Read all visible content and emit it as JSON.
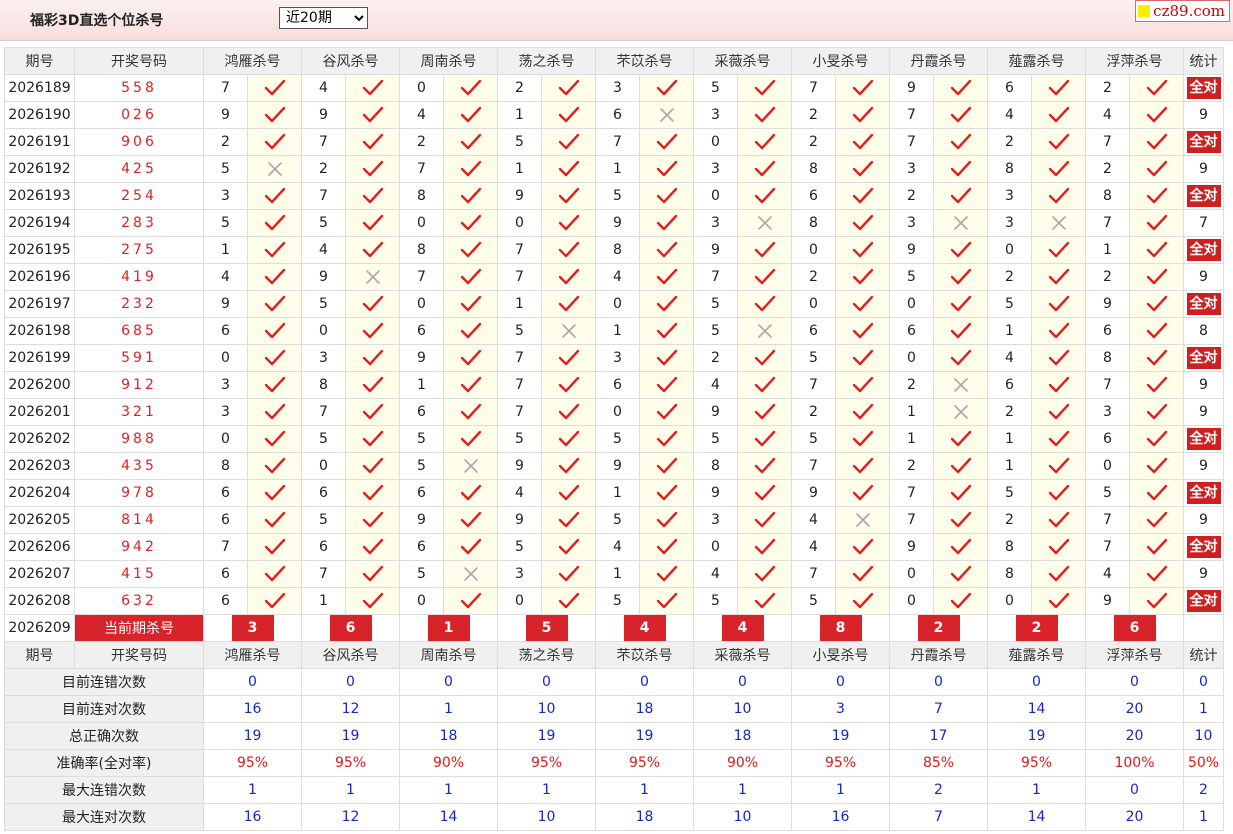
{
  "header": {
    "title": "福彩3D直选个位杀号",
    "period_select": "近20期",
    "brand": "cz89.com"
  },
  "columns": [
    "期号",
    "开奖号码",
    "鸿雁杀号",
    "谷风杀号",
    "周南杀号",
    "荡之杀号",
    "芣苡杀号",
    "采薇杀号",
    "小旻杀号",
    "丹霞杀号",
    "薤露杀号",
    "浮萍杀号",
    "统计"
  ],
  "rows": [
    {
      "q": "2026189",
      "kj": "558",
      "k": [
        [
          "7",
          1
        ],
        [
          "4",
          1
        ],
        [
          "0",
          1
        ],
        [
          "2",
          1
        ],
        [
          "3",
          1
        ],
        [
          "5",
          1
        ],
        [
          "7",
          1
        ],
        [
          "9",
          1
        ],
        [
          "6",
          1
        ],
        [
          "2",
          1
        ]
      ],
      "tj": "全对"
    },
    {
      "q": "2026190",
      "kj": "026",
      "k": [
        [
          "9",
          1
        ],
        [
          "9",
          1
        ],
        [
          "4",
          1
        ],
        [
          "1",
          1
        ],
        [
          "6",
          0
        ],
        [
          "3",
          1
        ],
        [
          "2",
          1
        ],
        [
          "7",
          1
        ],
        [
          "4",
          1
        ],
        [
          "4",
          1
        ]
      ],
      "tj": "9"
    },
    {
      "q": "2026191",
      "kj": "906",
      "k": [
        [
          "2",
          1
        ],
        [
          "7",
          1
        ],
        [
          "2",
          1
        ],
        [
          "5",
          1
        ],
        [
          "7",
          1
        ],
        [
          "0",
          1
        ],
        [
          "2",
          1
        ],
        [
          "7",
          1
        ],
        [
          "2",
          1
        ],
        [
          "7",
          1
        ]
      ],
      "tj": "全对"
    },
    {
      "q": "2026192",
      "kj": "425",
      "k": [
        [
          "5",
          0
        ],
        [
          "2",
          1
        ],
        [
          "7",
          1
        ],
        [
          "1",
          1
        ],
        [
          "1",
          1
        ],
        [
          "3",
          1
        ],
        [
          "8",
          1
        ],
        [
          "3",
          1
        ],
        [
          "8",
          1
        ],
        [
          "2",
          1
        ]
      ],
      "tj": "9"
    },
    {
      "q": "2026193",
      "kj": "254",
      "k": [
        [
          "3",
          1
        ],
        [
          "7",
          1
        ],
        [
          "8",
          1
        ],
        [
          "9",
          1
        ],
        [
          "5",
          1
        ],
        [
          "0",
          1
        ],
        [
          "6",
          1
        ],
        [
          "2",
          1
        ],
        [
          "3",
          1
        ],
        [
          "8",
          1
        ]
      ],
      "tj": "全对"
    },
    {
      "q": "2026194",
      "kj": "283",
      "k": [
        [
          "5",
          1
        ],
        [
          "5",
          1
        ],
        [
          "0",
          1
        ],
        [
          "0",
          1
        ],
        [
          "9",
          1
        ],
        [
          "3",
          0
        ],
        [
          "8",
          1
        ],
        [
          "3",
          0
        ],
        [
          "3",
          0
        ],
        [
          "7",
          1
        ]
      ],
      "tj": "7"
    },
    {
      "q": "2026195",
      "kj": "275",
      "k": [
        [
          "1",
          1
        ],
        [
          "4",
          1
        ],
        [
          "8",
          1
        ],
        [
          "7",
          1
        ],
        [
          "8",
          1
        ],
        [
          "9",
          1
        ],
        [
          "0",
          1
        ],
        [
          "9",
          1
        ],
        [
          "0",
          1
        ],
        [
          "1",
          1
        ]
      ],
      "tj": "全对"
    },
    {
      "q": "2026196",
      "kj": "419",
      "k": [
        [
          "4",
          1
        ],
        [
          "9",
          0
        ],
        [
          "7",
          1
        ],
        [
          "7",
          1
        ],
        [
          "4",
          1
        ],
        [
          "7",
          1
        ],
        [
          "2",
          1
        ],
        [
          "5",
          1
        ],
        [
          "2",
          1
        ],
        [
          "2",
          1
        ]
      ],
      "tj": "9"
    },
    {
      "q": "2026197",
      "kj": "232",
      "k": [
        [
          "9",
          1
        ],
        [
          "5",
          1
        ],
        [
          "0",
          1
        ],
        [
          "1",
          1
        ],
        [
          "0",
          1
        ],
        [
          "5",
          1
        ],
        [
          "0",
          1
        ],
        [
          "0",
          1
        ],
        [
          "5",
          1
        ],
        [
          "9",
          1
        ]
      ],
      "tj": "全对"
    },
    {
      "q": "2026198",
      "kj": "685",
      "k": [
        [
          "6",
          1
        ],
        [
          "0",
          1
        ],
        [
          "6",
          1
        ],
        [
          "5",
          0
        ],
        [
          "1",
          1
        ],
        [
          "5",
          0
        ],
        [
          "6",
          1
        ],
        [
          "6",
          1
        ],
        [
          "1",
          1
        ],
        [
          "6",
          1
        ]
      ],
      "tj": "8"
    },
    {
      "q": "2026199",
      "kj": "591",
      "k": [
        [
          "0",
          1
        ],
        [
          "3",
          1
        ],
        [
          "9",
          1
        ],
        [
          "7",
          1
        ],
        [
          "3",
          1
        ],
        [
          "2",
          1
        ],
        [
          "5",
          1
        ],
        [
          "0",
          1
        ],
        [
          "4",
          1
        ],
        [
          "8",
          1
        ]
      ],
      "tj": "全对"
    },
    {
      "q": "2026200",
      "kj": "912",
      "k": [
        [
          "3",
          1
        ],
        [
          "8",
          1
        ],
        [
          "1",
          1
        ],
        [
          "7",
          1
        ],
        [
          "6",
          1
        ],
        [
          "4",
          1
        ],
        [
          "7",
          1
        ],
        [
          "2",
          0
        ],
        [
          "6",
          1
        ],
        [
          "7",
          1
        ]
      ],
      "tj": "9"
    },
    {
      "q": "2026201",
      "kj": "321",
      "k": [
        [
          "3",
          1
        ],
        [
          "7",
          1
        ],
        [
          "6",
          1
        ],
        [
          "7",
          1
        ],
        [
          "0",
          1
        ],
        [
          "9",
          1
        ],
        [
          "2",
          1
        ],
        [
          "1",
          0
        ],
        [
          "2",
          1
        ],
        [
          "3",
          1
        ]
      ],
      "tj": "9"
    },
    {
      "q": "2026202",
      "kj": "988",
      "k": [
        [
          "0",
          1
        ],
        [
          "5",
          1
        ],
        [
          "5",
          1
        ],
        [
          "5",
          1
        ],
        [
          "5",
          1
        ],
        [
          "5",
          1
        ],
        [
          "5",
          1
        ],
        [
          "1",
          1
        ],
        [
          "1",
          1
        ],
        [
          "6",
          1
        ]
      ],
      "tj": "全对"
    },
    {
      "q": "2026203",
      "kj": "435",
      "k": [
        [
          "8",
          1
        ],
        [
          "0",
          1
        ],
        [
          "5",
          0
        ],
        [
          "9",
          1
        ],
        [
          "9",
          1
        ],
        [
          "8",
          1
        ],
        [
          "7",
          1
        ],
        [
          "2",
          1
        ],
        [
          "1",
          1
        ],
        [
          "0",
          1
        ]
      ],
      "tj": "9"
    },
    {
      "q": "2026204",
      "kj": "978",
      "k": [
        [
          "6",
          1
        ],
        [
          "6",
          1
        ],
        [
          "6",
          1
        ],
        [
          "4",
          1
        ],
        [
          "1",
          1
        ],
        [
          "9",
          1
        ],
        [
          "9",
          1
        ],
        [
          "7",
          1
        ],
        [
          "5",
          1
        ],
        [
          "5",
          1
        ]
      ],
      "tj": "全对"
    },
    {
      "q": "2026205",
      "kj": "814",
      "k": [
        [
          "6",
          1
        ],
        [
          "5",
          1
        ],
        [
          "9",
          1
        ],
        [
          "9",
          1
        ],
        [
          "5",
          1
        ],
        [
          "3",
          1
        ],
        [
          "4",
          0
        ],
        [
          "7",
          1
        ],
        [
          "2",
          1
        ],
        [
          "7",
          1
        ]
      ],
      "tj": "9"
    },
    {
      "q": "2026206",
      "kj": "942",
      "k": [
        [
          "7",
          1
        ],
        [
          "6",
          1
        ],
        [
          "6",
          1
        ],
        [
          "5",
          1
        ],
        [
          "4",
          1
        ],
        [
          "0",
          1
        ],
        [
          "4",
          1
        ],
        [
          "9",
          1
        ],
        [
          "8",
          1
        ],
        [
          "7",
          1
        ]
      ],
      "tj": "全对"
    },
    {
      "q": "2026207",
      "kj": "415",
      "k": [
        [
          "6",
          1
        ],
        [
          "7",
          1
        ],
        [
          "5",
          0
        ],
        [
          "3",
          1
        ],
        [
          "1",
          1
        ],
        [
          "4",
          1
        ],
        [
          "7",
          1
        ],
        [
          "0",
          1
        ],
        [
          "8",
          1
        ],
        [
          "4",
          1
        ]
      ],
      "tj": "9"
    },
    {
      "q": "2026208",
      "kj": "632",
      "k": [
        [
          "6",
          1
        ],
        [
          "1",
          1
        ],
        [
          "0",
          1
        ],
        [
          "0",
          1
        ],
        [
          "5",
          1
        ],
        [
          "5",
          1
        ],
        [
          "5",
          1
        ],
        [
          "0",
          1
        ],
        [
          "0",
          1
        ],
        [
          "9",
          1
        ]
      ],
      "tj": "全对"
    }
  ],
  "current": {
    "q": "2026209",
    "label": "当前期杀号",
    "k": [
      "3",
      "6",
      "1",
      "5",
      "4",
      "4",
      "8",
      "2",
      "2",
      "6"
    ]
  },
  "stats": [
    {
      "label": "目前连错次数",
      "v": [
        "0",
        "0",
        "0",
        "0",
        "0",
        "0",
        "0",
        "0",
        "0",
        "0",
        "0"
      ]
    },
    {
      "label": "目前连对次数",
      "v": [
        "16",
        "12",
        "1",
        "10",
        "18",
        "10",
        "3",
        "7",
        "14",
        "20",
        "1"
      ]
    },
    {
      "label": "总正确次数",
      "v": [
        "19",
        "19",
        "18",
        "19",
        "19",
        "18",
        "19",
        "17",
        "19",
        "20",
        "10"
      ]
    },
    {
      "label": "准确率(全对率)",
      "v": [
        "95%",
        "95%",
        "90%",
        "95%",
        "95%",
        "90%",
        "95%",
        "85%",
        "95%",
        "100%",
        "50%"
      ],
      "red": true
    },
    {
      "label": "最大连错次数",
      "v": [
        "1",
        "1",
        "1",
        "1",
        "1",
        "1",
        "1",
        "2",
        "1",
        "0",
        "2"
      ]
    },
    {
      "label": "最大连对次数",
      "v": [
        "16",
        "12",
        "14",
        "10",
        "18",
        "10",
        "16",
        "7",
        "14",
        "20",
        "1"
      ]
    }
  ],
  "colors": {
    "accent": "#d8232a",
    "check": "#e02020",
    "cross": "#a8a8a8",
    "stat_blue": "#1428c8"
  }
}
